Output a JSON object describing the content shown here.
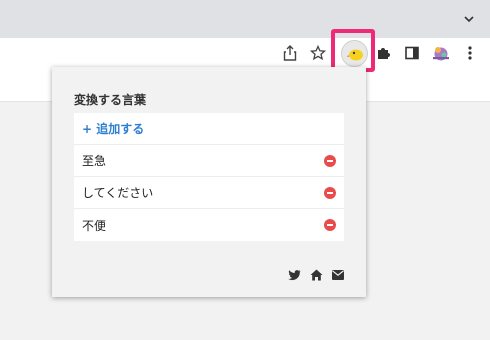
{
  "browser": {
    "tabstrip_chevron_icon": "chevron-down-icon",
    "toolbar_icons": [
      "share-icon",
      "star-icon",
      "extension-icon",
      "puzzle-icon",
      "side-panel-icon",
      "profile-avatar",
      "more-vert-icon"
    ],
    "highlight_color": "#ee2a78"
  },
  "popup": {
    "title": "変換する言葉",
    "add_label": "+ 追加する",
    "words": [
      {
        "text": "至急"
      },
      {
        "text": "してください"
      },
      {
        "text": "不便"
      }
    ],
    "footer_icons": [
      "twitter-icon",
      "home-icon",
      "mail-icon"
    ],
    "accent_color": "#2f7fd1",
    "remove_color": "#e94b4b"
  }
}
